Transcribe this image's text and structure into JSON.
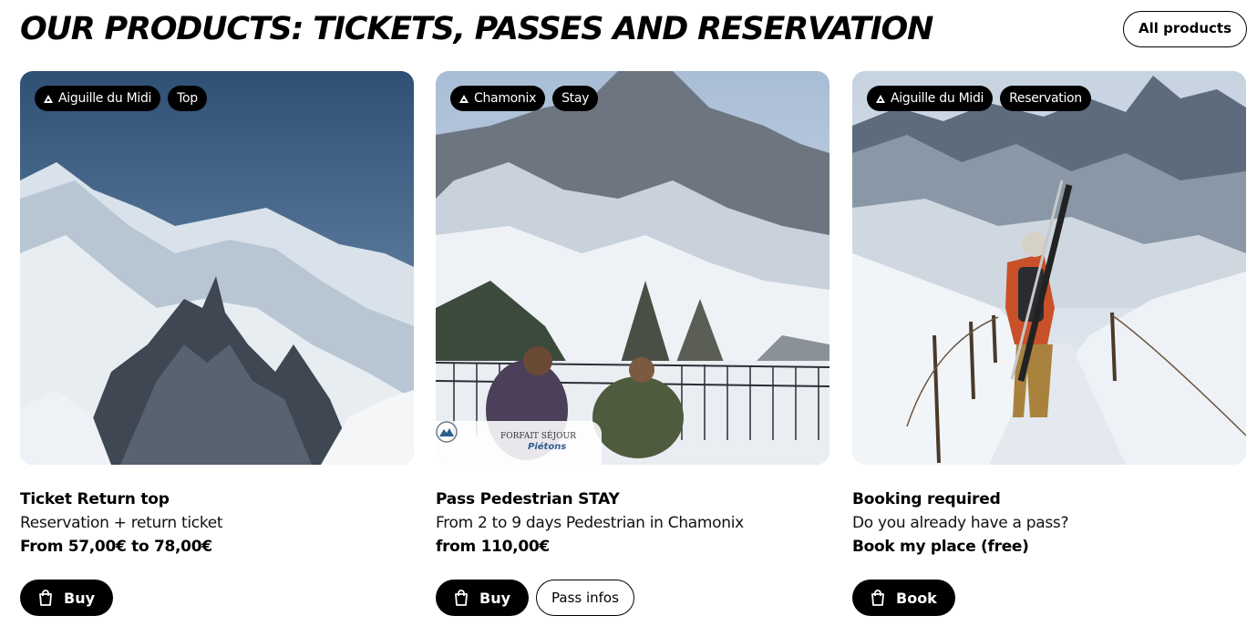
{
  "header": {
    "title": "OUR PRODUCTS: TICKETS, PASSES AND RESERVATION",
    "all_products_label": "All products"
  },
  "colors": {
    "button_bg": "#000000",
    "button_text": "#ffffff",
    "badge_accent": "#2c5d8f"
  },
  "cards": [
    {
      "tags": [
        "Aiguille du Midi",
        "Top"
      ],
      "image": "mountain-peak-photo",
      "title": "Ticket Return top",
      "description": "Reservation + return ticket",
      "price": "From 57,00€ to 78,00€",
      "primary_button": "Buy",
      "primary_icon": "shopping-bag-icon"
    },
    {
      "tags": [
        "Chamonix",
        "Stay"
      ],
      "image": "hikers-terrace-photo",
      "badge": {
        "line1": "FORFAIT SÉJOUR",
        "line2": "Piétons"
      },
      "title": "Pass Pedestrian STAY",
      "description": "From 2 to 9 days Pedestrian in Chamonix",
      "price": "from 110,00€",
      "primary_button": "Buy",
      "primary_icon": "shopping-bag-icon",
      "secondary_button": "Pass infos"
    },
    {
      "tags": [
        "Aiguille du Midi",
        "Reservation"
      ],
      "image": "skier-ridge-photo",
      "title": "Booking required",
      "description": "Do you already have a pass?",
      "price": "Book my place (free)",
      "primary_button": "Book",
      "primary_icon": "shopping-bag-icon"
    }
  ]
}
